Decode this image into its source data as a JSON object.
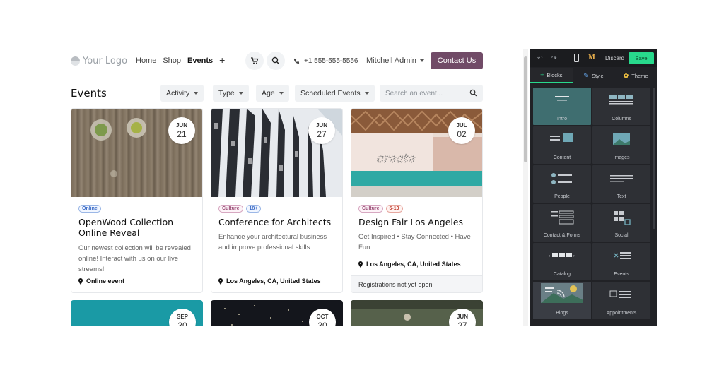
{
  "site": {
    "logo": "Your Logo",
    "menu": [
      "Home",
      "Shop",
      "Events",
      "+"
    ],
    "phone": "+1 555-555-5556",
    "admin": "Mitchell Admin",
    "contact": "Contact Us"
  },
  "events": {
    "title": "Events",
    "filters": [
      "Activity",
      "Type",
      "Age",
      "Scheduled Events"
    ],
    "search_placeholder": "Search an event...",
    "cards": [
      {
        "month": "JUN",
        "day": "21",
        "tags": [
          "Online"
        ],
        "title": "OpenWood Collection Online Reveal",
        "desc": "Our newest collection will be revealed online! Interact with us on our live streams!",
        "location": "Online event",
        "footer": ""
      },
      {
        "month": "JUN",
        "day": "27",
        "tags": [
          "Culture",
          "18+"
        ],
        "title": "Conference for Architects",
        "desc": "Enhance your architectural business and improve professional skills.",
        "location": "Los Angeles, CA, United States",
        "footer": ""
      },
      {
        "month": "JUL",
        "day": "02",
        "tags": [
          "Culture",
          "5-10"
        ],
        "title": "Design Fair Los Angeles",
        "desc": "Get Inspired • Stay Connected • Have Fun",
        "location": "Los Angeles, CA, United States",
        "footer": "Registrations not yet open",
        "image_text": "create"
      }
    ],
    "second_row": [
      {
        "month": "SEP",
        "day": "30"
      },
      {
        "month": "OCT",
        "day": "30"
      },
      {
        "month": "JUN",
        "day": "27"
      }
    ]
  },
  "editor": {
    "discard": "Discard",
    "save": "Save",
    "tabs": [
      "Blocks",
      "Style",
      "Theme"
    ],
    "blocks": [
      "Intro",
      "Columns",
      "Content",
      "Images",
      "People",
      "Text",
      "Contact & Forms",
      "Social",
      "Catalog",
      "Events",
      "Blogs",
      "Appointments"
    ]
  }
}
